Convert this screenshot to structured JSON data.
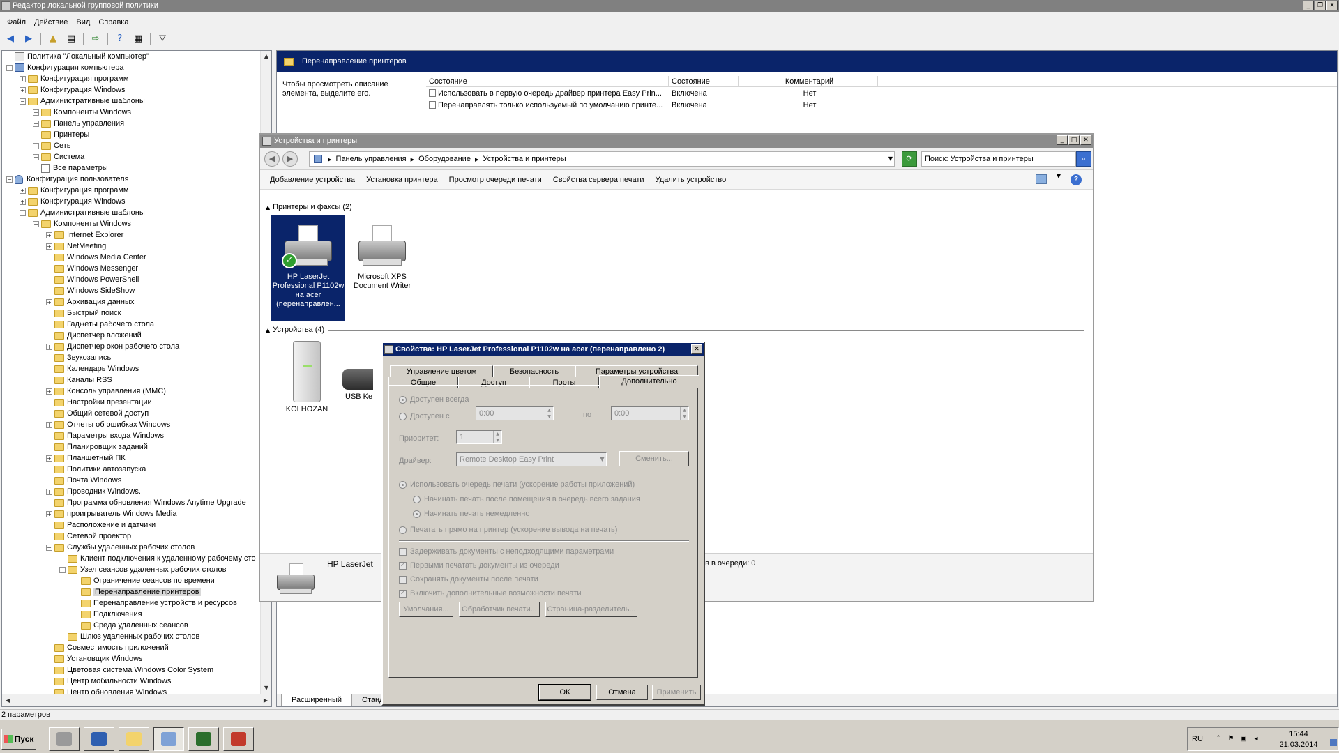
{
  "main_window": {
    "title": "Редактор локальной групповой политики",
    "menu": [
      "Файл",
      "Действие",
      "Вид",
      "Справка"
    ],
    "toolbar_icons": [
      "back-icon",
      "forward-icon",
      "up-folder-icon",
      "show-hide-tree-icon",
      "export-list-icon",
      "help-icon",
      "properties-icon",
      "filter-icon"
    ],
    "status": "2 параметров"
  },
  "tree": [
    {
      "label": "Политика \"Локальный компьютер\"",
      "level": 0,
      "exp": "",
      "icon": "policy"
    },
    {
      "label": "Конфигурация компьютера",
      "level": 0,
      "exp": "−",
      "icon": "computer"
    },
    {
      "label": "Конфигурация программ",
      "level": 1,
      "exp": "+",
      "icon": "folder"
    },
    {
      "label": "Конфигурация Windows",
      "level": 1,
      "exp": "+",
      "icon": "folder"
    },
    {
      "label": "Административные шаблоны",
      "level": 1,
      "exp": "−",
      "icon": "folder"
    },
    {
      "label": "Компоненты Windows",
      "level": 2,
      "exp": "+",
      "icon": "folder"
    },
    {
      "label": "Панель управления",
      "level": 2,
      "exp": "+",
      "icon": "folder"
    },
    {
      "label": "Принтеры",
      "level": 2,
      "exp": "",
      "icon": "folder"
    },
    {
      "label": "Сеть",
      "level": 2,
      "exp": "+",
      "icon": "folder"
    },
    {
      "label": "Система",
      "level": 2,
      "exp": "+",
      "icon": "folder"
    },
    {
      "label": "Все параметры",
      "level": 2,
      "exp": "",
      "icon": "doc"
    },
    {
      "label": "Конфигурация пользователя",
      "level": 0,
      "exp": "−",
      "icon": "user"
    },
    {
      "label": "Конфигурация программ",
      "level": 1,
      "exp": "+",
      "icon": "folder"
    },
    {
      "label": "Конфигурация Windows",
      "level": 1,
      "exp": "+",
      "icon": "folder"
    },
    {
      "label": "Административные шаблоны",
      "level": 1,
      "exp": "−",
      "icon": "folder"
    },
    {
      "label": "Компоненты Windows",
      "level": 2,
      "exp": "−",
      "icon": "folder"
    },
    {
      "label": "Internet Explorer",
      "level": 3,
      "exp": "+",
      "icon": "folder"
    },
    {
      "label": "NetMeeting",
      "level": 3,
      "exp": "+",
      "icon": "folder"
    },
    {
      "label": "Windows Media Center",
      "level": 3,
      "exp": "",
      "icon": "folder"
    },
    {
      "label": "Windows Messenger",
      "level": 3,
      "exp": "",
      "icon": "folder"
    },
    {
      "label": "Windows PowerShell",
      "level": 3,
      "exp": "",
      "icon": "folder"
    },
    {
      "label": "Windows SideShow",
      "level": 3,
      "exp": "",
      "icon": "folder"
    },
    {
      "label": "Архивация данных",
      "level": 3,
      "exp": "+",
      "icon": "folder"
    },
    {
      "label": "Быстрый поиск",
      "level": 3,
      "exp": "",
      "icon": "folder"
    },
    {
      "label": "Гаджеты рабочего стола",
      "level": 3,
      "exp": "",
      "icon": "folder"
    },
    {
      "label": "Диспетчер вложений",
      "level": 3,
      "exp": "",
      "icon": "folder"
    },
    {
      "label": "Диспетчер окон рабочего стола",
      "level": 3,
      "exp": "+",
      "icon": "folder"
    },
    {
      "label": "Звукозапись",
      "level": 3,
      "exp": "",
      "icon": "folder"
    },
    {
      "label": "Календарь Windows",
      "level": 3,
      "exp": "",
      "icon": "folder"
    },
    {
      "label": "Каналы RSS",
      "level": 3,
      "exp": "",
      "icon": "folder"
    },
    {
      "label": "Консоль управления (MMC)",
      "level": 3,
      "exp": "+",
      "icon": "folder"
    },
    {
      "label": "Настройки презентации",
      "level": 3,
      "exp": "",
      "icon": "folder"
    },
    {
      "label": "Общий сетевой доступ",
      "level": 3,
      "exp": "",
      "icon": "folder"
    },
    {
      "label": "Отчеты об ошибках Windows",
      "level": 3,
      "exp": "+",
      "icon": "folder"
    },
    {
      "label": "Параметры входа Windows",
      "level": 3,
      "exp": "",
      "icon": "folder"
    },
    {
      "label": "Планировщик заданий",
      "level": 3,
      "exp": "",
      "icon": "folder"
    },
    {
      "label": "Планшетный ПК",
      "level": 3,
      "exp": "+",
      "icon": "folder"
    },
    {
      "label": "Политики автозапуска",
      "level": 3,
      "exp": "",
      "icon": "folder"
    },
    {
      "label": "Почта Windows",
      "level": 3,
      "exp": "",
      "icon": "folder"
    },
    {
      "label": "Проводник Windows.",
      "level": 3,
      "exp": "+",
      "icon": "folder"
    },
    {
      "label": "Программа обновления Windows Anytime Upgrade",
      "level": 3,
      "exp": "",
      "icon": "folder"
    },
    {
      "label": "проигрыватель Windows Media",
      "level": 3,
      "exp": "+",
      "icon": "folder"
    },
    {
      "label": "Расположение и датчики",
      "level": 3,
      "exp": "",
      "icon": "folder"
    },
    {
      "label": "Сетевой проектор",
      "level": 3,
      "exp": "",
      "icon": "folder"
    },
    {
      "label": "Службы удаленных рабочих столов",
      "level": 3,
      "exp": "−",
      "icon": "folder"
    },
    {
      "label": "Клиент подключения к удаленному рабочему сто",
      "level": 4,
      "exp": "",
      "icon": "folder"
    },
    {
      "label": "Узел сеансов удаленных рабочих столов",
      "level": 4,
      "exp": "−",
      "icon": "folder"
    },
    {
      "label": "Ограничение сеансов по времени",
      "level": 5,
      "exp": "",
      "icon": "folder"
    },
    {
      "label": "Перенаправление принтеров",
      "level": 5,
      "exp": "",
      "icon": "folder",
      "selected": true
    },
    {
      "label": "Перенаправление устройств и ресурсов",
      "level": 5,
      "exp": "",
      "icon": "folder"
    },
    {
      "label": "Подключения",
      "level": 5,
      "exp": "",
      "icon": "folder"
    },
    {
      "label": "Среда удаленных сеансов",
      "level": 5,
      "exp": "",
      "icon": "folder"
    },
    {
      "label": "Шлюз удаленных рабочих столов",
      "level": 4,
      "exp": "",
      "icon": "folder"
    },
    {
      "label": "Совместимость приложений",
      "level": 3,
      "exp": "",
      "icon": "folder"
    },
    {
      "label": "Установщик Windows",
      "level": 3,
      "exp": "",
      "icon": "folder"
    },
    {
      "label": "Цветовая система Windows Color System",
      "level": 3,
      "exp": "",
      "icon": "folder"
    },
    {
      "label": "Центр мобильности Windows",
      "level": 3,
      "exp": "",
      "icon": "folder"
    },
    {
      "label": "Центр обновления Windows",
      "level": 3,
      "exp": "",
      "icon": "folder"
    }
  ],
  "right_panel": {
    "header": "Перенаправление принтеров",
    "description": "Чтобы просмотреть описание элемента, выделите его.",
    "columns": [
      "Состояние",
      "Состояние",
      "Комментарий"
    ],
    "rows": [
      {
        "name": "Использовать в первую очередь драйвер принтера Easy Prin...",
        "state": "Включена",
        "comment": "Нет"
      },
      {
        "name": "Перенаправлять только используемый по умолчанию принте...",
        "state": "Включена",
        "comment": "Нет"
      }
    ],
    "tabs": [
      "Расширенный",
      "Стандар"
    ]
  },
  "devices_window": {
    "title": "Устройства и принтеры",
    "breadcrumb": [
      "Панель управления",
      "Оборудование",
      "Устройства и принтеры"
    ],
    "search_placeholder": "Поиск: Устройства и принтеры",
    "commands": [
      "Добавление устройства",
      "Установка принтера",
      "Просмотр очереди печати",
      "Свойства сервера печати",
      "Удалить устройство"
    ],
    "group_printers": "Принтеры и факсы (2)",
    "group_devices": "Устройства (4)",
    "printers": [
      {
        "name": "HP LaserJet Professional P1102w на acer (перенаправлен...",
        "selected": true,
        "default": true
      },
      {
        "name": "Microsoft XPS Document Writer",
        "selected": false,
        "default": false
      }
    ],
    "devices": [
      {
        "name": "KOLHOZAN",
        "icon": "computer-tower-icon"
      },
      {
        "name": "USB Ke",
        "icon": "keyboard-icon"
      }
    ],
    "details_name": "HP LaserJet",
    "details_queue": "ов в очереди: 0"
  },
  "props_dialog": {
    "title": "Свойства: HP LaserJet Professional P1102w на acer (перенаправлено 2)",
    "tabs_row1": [
      "Управление цветом",
      "Безопасность",
      "Параметры устройства"
    ],
    "tabs_row2": [
      "Общие",
      "Доступ",
      "Порты",
      "Дополнительно"
    ],
    "active_tab": "Дополнительно",
    "always_available": "Доступен всегда",
    "available_from": "Доступен с",
    "time_from": "0:00",
    "to_label": "по",
    "time_to": "0:00",
    "priority_label": "Приоритет:",
    "priority_value": "1",
    "driver_label": "Драйвер:",
    "driver_value": "Remote Desktop Easy Print",
    "change_button": "Сменить...",
    "spool_option": "Использовать очередь печати (ускорение работы приложений)",
    "spool_after_last": "Начинать печать после помещения в очередь всего задания",
    "spool_immediately": "Начинать печать немедленно",
    "print_direct": "Печатать прямо на принтер (ускорение вывода на печать)",
    "hold_mismatched": "Задерживать документы с неподходящими параметрами",
    "print_spooled_first": "Первыми печатать документы из очереди",
    "keep_printed": "Сохранять документы после печати",
    "advanced_features": "Включить дополнительные возможности печати",
    "defaults_button": "Умолчания...",
    "processor_button": "Обработчик печати...",
    "separator_button": "Страница-разделитель...",
    "ok_button": "ОК",
    "cancel_button": "Отмена",
    "apply_button": "Применить"
  },
  "taskbar": {
    "start_label": "Пуск",
    "apps": [
      "server-manager-icon",
      "powershell-icon",
      "explorer-icon",
      "control-panel-icon",
      "task-manager-icon",
      "toolbox-icon"
    ],
    "lang": "RU",
    "time": "15:44",
    "date": "21.03.2014"
  }
}
